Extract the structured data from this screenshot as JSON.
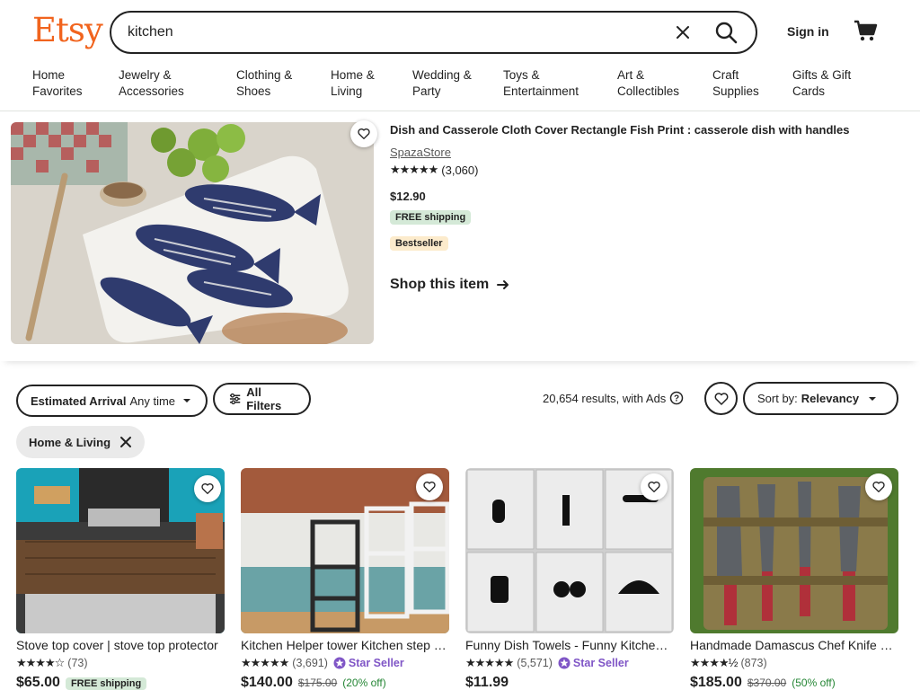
{
  "header": {
    "logo": "Etsy",
    "search_value": "kitchen",
    "signin_label": "Sign in",
    "accent_color": "#f1641e"
  },
  "nav": [
    {
      "label": "Home\nFavorites"
    },
    {
      "label": "Jewelry &\nAccessories"
    },
    {
      "label": "Clothing &\nShoes"
    },
    {
      "label": "Home &\nLiving"
    },
    {
      "label": "Wedding &\nParty"
    },
    {
      "label": "Toys &\nEntertainment"
    },
    {
      "label": "Art &\nCollectibles"
    },
    {
      "label": "Craft\nSupplies"
    },
    {
      "label": "Gifts & Gift\nCards"
    }
  ],
  "ad": {
    "title": "Dish and Casserole Cloth Cover Rectangle Fish Print : casserole dish with handles",
    "shop": "SpazaStore",
    "stars": "★★★★★",
    "rating": 5,
    "reviews": "(3,060)",
    "price": "$12.90",
    "free_shipping": "FREE shipping",
    "bestseller": "Bestseller",
    "shop_link": "Shop this item"
  },
  "filters": {
    "arrival_label": "Estimated Arrival",
    "arrival_value": "Any time",
    "all_filters": "All Filters",
    "results": "20,654 results, with Ads",
    "sort_label": "Sort by:",
    "sort_value": "Relevancy",
    "chip": "Home & Living"
  },
  "listings": [
    {
      "title": "Stove top cover | stove top protector",
      "stars": "★★★★☆",
      "rating": 4,
      "reviews": "(73)",
      "star_seller": "",
      "price": "$65.00",
      "original": "",
      "discount": "",
      "free_shipping": "FREE shipping"
    },
    {
      "title": "Kitchen Helper tower Kitchen step stool",
      "stars": "★★★★★",
      "rating": 5,
      "reviews": "(3,691)",
      "star_seller": "Star Seller",
      "price": "$140.00",
      "original": "$175.00",
      "discount": "(20% off)",
      "free_shipping": ""
    },
    {
      "title": "Funny Dish Towels - Funny Kitchen Towels",
      "stars": "★★★★★",
      "rating": 5,
      "reviews": "(5,571)",
      "star_seller": "Star Seller",
      "price": "$11.99",
      "original": "",
      "discount": "",
      "free_shipping": ""
    },
    {
      "title": "Handmade Damascus Chef Knife Set",
      "stars": "★★★★½",
      "rating": 4.5,
      "reviews": "(873)",
      "star_seller": "",
      "price": "$185.00",
      "original": "$370.00",
      "discount": "(50% off)",
      "free_shipping": ""
    }
  ]
}
